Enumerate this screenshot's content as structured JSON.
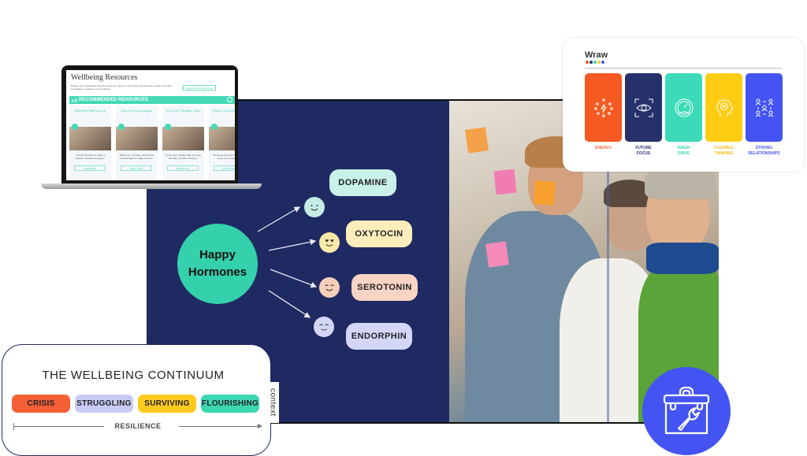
{
  "laptop": {
    "title": "Wellbeing Resources",
    "description": "Browse your individually curated resources, based on your Wraw questionnaire results, and gain knowledge to enhance your resilience.",
    "filter_button": "Search & Filter Resources",
    "banner": "RECOMMENDED RESOURCES",
    "cards": [
      {
        "title": "What Went Well Exercise",
        "description": "Use this exercise to foster a positive mindset and grow...",
        "button": "Read Article"
      },
      {
        "title": "Discover Your Strengths",
        "description": "Reflect on, consider, and identify core strengths to utilise them in...",
        "button": "Read Article"
      },
      {
        "title": "Let Go Of The Inner Critic",
        "description": "If you aren't familiar with your own self-talk, practice noticing it.",
        "button": "Read Article"
      },
      {
        "title": "What Is A Growth Mindset",
        "description": "Fostering a growth mindset can serve as a powerful m...",
        "button": "Read Article"
      }
    ]
  },
  "diagram": {
    "hub_line1": "Happy",
    "hub_line2": "Hormones",
    "hormones": [
      {
        "label": "DOPAMINE",
        "color": "#c9f1ea",
        "face_color": "#c4ece5",
        "face": "smile"
      },
      {
        "label": "OXYTOCIN",
        "color": "#fbeebb",
        "face_color": "#f8e9a8",
        "face": "heart-eyes"
      },
      {
        "label": "SEROTONIN",
        "color": "#f9d3c4",
        "face_color": "#f6ceb9",
        "face": "happy-closed"
      },
      {
        "label": "ENDORPHIN",
        "color": "#d4d6f8",
        "face_color": "#d3d6f6",
        "face": "calm"
      }
    ]
  },
  "wraw": {
    "logo": "Wraw",
    "logo_dots": [
      "#f15a24",
      "#2b3470",
      "#3fd6b4",
      "#ffcf1f",
      "#4454f2"
    ],
    "pillars": [
      {
        "label_line1": "ENERGY",
        "label_line2": "",
        "color": "#f45a22",
        "label_color": "#f26a3c",
        "icon": "energy-icon"
      },
      {
        "label_line1": "FUTURE",
        "label_line2": "FOCUS",
        "color": "#26306a",
        "label_color": "#2b3470",
        "icon": "eye-focus-icon"
      },
      {
        "label_line1": "INNER",
        "label_line2": "DRIVE",
        "color": "#3cdab8",
        "label_color": "#3fd6b4",
        "icon": "gauge-icon"
      },
      {
        "label_line1": "FLEXIBLE",
        "label_line2": "THINKING",
        "color": "#ffcc14",
        "label_color": "#f2be14",
        "icon": "head-brain-icon"
      },
      {
        "label_line1": "STRONG",
        "label_line2": "RELATIONSHIPS",
        "color": "#4454f2",
        "label_color": "#4454f2",
        "icon": "people-network-icon"
      }
    ]
  },
  "continuum": {
    "title": "THE WELLBEING CONTINUUM",
    "stages": [
      {
        "label": "CRISIS",
        "color": "#f45f35"
      },
      {
        "label": "STRUGGLING",
        "color": "#c8cbf6"
      },
      {
        "label": "SURVIVING",
        "color": "#ffc91f"
      },
      {
        "label": "FLOURISHING",
        "color": "#3dd6b3"
      }
    ],
    "axis_label": "RESILIENCE",
    "context_label": "context"
  },
  "colors": {
    "panel_bg": "#1f2a63",
    "hub": "#35d0ac",
    "toolbox_bg": "#4454f2",
    "accent_teal": "#45d9b8"
  }
}
